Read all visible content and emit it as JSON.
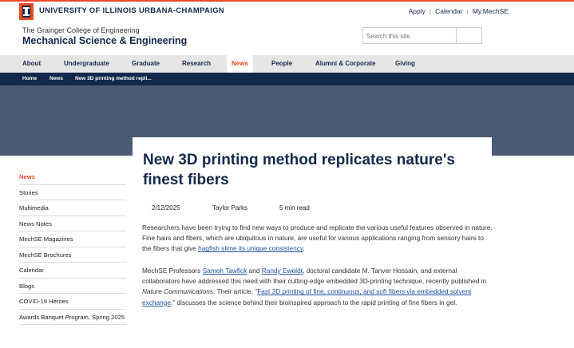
{
  "university": {
    "name": "UNIVERSITY OF ILLINOIS URBANA-CHAMPAIGN"
  },
  "utility_links": [
    "Apply",
    "Calendar",
    "My.MechSE"
  ],
  "header": {
    "college": "The Grainger College of Engineering",
    "department": "Mechanical Science & Engineering",
    "search_placeholder": "Search this site"
  },
  "main_nav": [
    {
      "label": "About"
    },
    {
      "label": "Undergraduate"
    },
    {
      "label": "Graduate"
    },
    {
      "label": "Research"
    },
    {
      "label": "News",
      "active": true
    },
    {
      "label": "People"
    },
    {
      "label": "Alumni & Corporate"
    },
    {
      "label": "Giving"
    }
  ],
  "breadcrumb": [
    "Home",
    "News",
    "New 3D printing method repli..."
  ],
  "sidebar": {
    "items": [
      {
        "label": "News",
        "active": true
      },
      {
        "label": "Stories"
      },
      {
        "label": "Multimedia"
      },
      {
        "label": "News Notes"
      },
      {
        "label": "MechSE Magazines"
      },
      {
        "label": "MechSE Brochures"
      },
      {
        "label": "Calendar"
      },
      {
        "label": "Blogs"
      },
      {
        "label": "COVID-19 Heroes"
      },
      {
        "label": "Awards Banquet Program, Spring 2025"
      }
    ]
  },
  "article": {
    "title_line1": "New 3D printing method replicates nature's",
    "title_line2": "finest fibers",
    "date": "2/12/2025",
    "author": "Taylor Parks",
    "read_time": "5 min read",
    "p1": {
      "text": "Researchers have been trying to find new ways to produce and replicate the various useful features observed in nature. Fine hairs and fibers, which are ubiquitous in nature, are useful for various applications ranging from sensory hairs to the fibers that give ",
      "link": "hagfish slime its unique consistency",
      "end": "."
    },
    "p2": {
      "t1": "MechSE Professors ",
      "link1": "Sameh Tawfick",
      "t2": " and ",
      "link2": "Randy Ewoldt",
      "t3": ", doctoral candidate M. Tanver Hossain, and external collaborators have addressed this need with their cutting-edge embedded 3D-printing technique, recently published in ",
      "journal": "Nature Communications",
      "t4": ". Their article, “",
      "link3": "Fast 3D printing of fine, continuous, and soft fibers via embedded solvent exchange",
      "t5": ",” discusses the science behind their bioinspired approach to the rapid printing of fine fibers in gel."
    }
  }
}
